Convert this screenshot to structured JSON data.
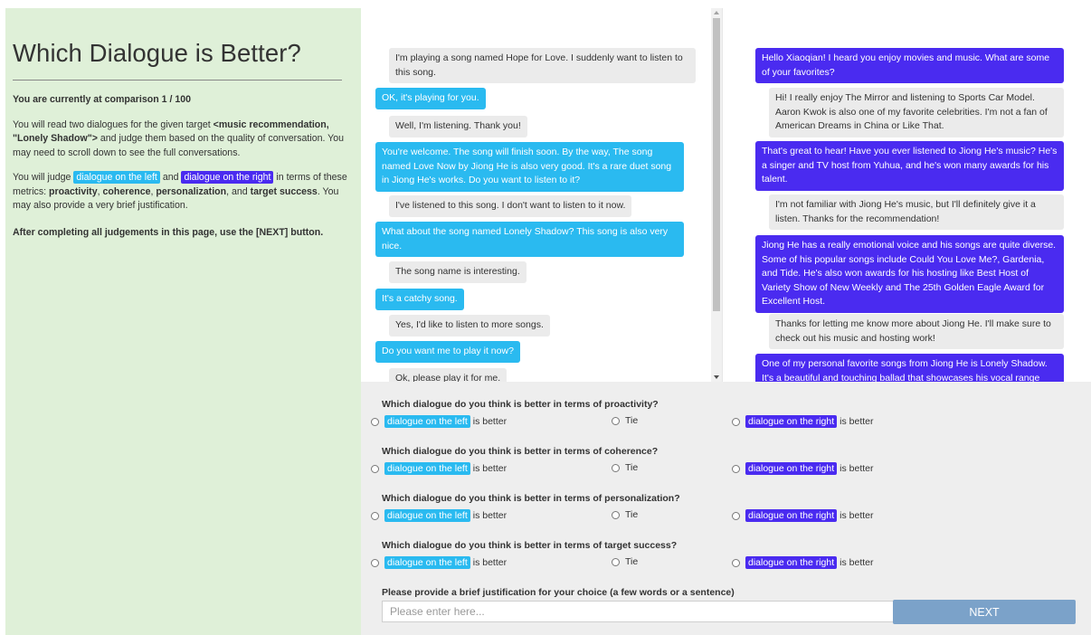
{
  "instructions": {
    "title": "Which Dialogue is Better?",
    "progress": "You are currently at comparison 1 / 100",
    "p1_pre": "You will read two dialogues for the given target ",
    "p1_target": "<music recommendation, \"Lonely Shadow\">",
    "p1_post": " and judge them based on the quality of conversation.   You may need to scroll down to see the full conversations.",
    "p2_pre": "You will judge ",
    "left_tag": "dialogue on the left",
    "and": " and ",
    "right_tag": "dialogue on the right",
    "p2_mid": " in terms of these metrics: ",
    "m1": "proactivity",
    "sep": ", ",
    "m2": "coherence",
    "m3": "personalization",
    "and2": ", and ",
    "m4": "target success",
    "p2_post": ". You may also provide a very brief justification.",
    "p3": "After completing all judgements in this page, use the [NEXT] button."
  },
  "dialogue_left": [
    {
      "role": "user",
      "text": "I'm playing a song named Hope for Love. I suddenly want to listen to this song."
    },
    {
      "role": "system",
      "text": "OK, it's playing for you."
    },
    {
      "role": "user",
      "text": "Well, I'm listening. Thank you!"
    },
    {
      "role": "system",
      "text": "You're welcome. The song will finish soon. By the way, The song named Love Now by Jiong He is also very good. It's a rare duet song in Jiong He's works. Do you want to listen to it?"
    },
    {
      "role": "user",
      "text": "I've listened to this song. I don't want to listen to it now."
    },
    {
      "role": "system",
      "text": "What about the song named Lonely Shadow? This song is also very nice."
    },
    {
      "role": "user",
      "text": "The song name is interesting."
    },
    {
      "role": "system",
      "text": "It's a catchy song."
    },
    {
      "role": "user",
      "text": "Yes, I'd like to listen to more songs."
    },
    {
      "role": "system",
      "text": "Do you want me to play it now?"
    },
    {
      "role": "user",
      "text": "Ok, please play it for me."
    }
  ],
  "dialogue_right": [
    {
      "role": "system",
      "text": "Hello Xiaoqian! I heard you enjoy movies and music. What are some of your favorites?"
    },
    {
      "role": "user",
      "text": "Hi! I really enjoy The Mirror and listening to Sports Car Model. Aaron Kwok is also one of my favorite celebrities. I'm not a fan of American Dreams in China or Like That."
    },
    {
      "role": "system",
      "text": "That's great to hear! Have you ever listened to Jiong He's music? He's a singer and TV host from Yuhua, and he's won many awards for his talent."
    },
    {
      "role": "user",
      "text": "I'm not familiar with Jiong He's music, but I'll definitely give it a listen. Thanks for the recommendation!"
    },
    {
      "role": "system",
      "text": "Jiong He has a really emotional voice and his songs are quite diverse. Some of his popular songs include Could You Love Me?, Gardenia, and Tide. He's also won awards for his hosting like Best Host of Variety Show of New Weekly and The 25th Golden Eagle Award for Excellent Host."
    },
    {
      "role": "user",
      "text": "Thanks for letting me know more about Jiong He. I'll make sure to check out his music and hosting work!"
    },
    {
      "role": "system",
      "text": "One of my personal favorite songs from Jiong He is Lonely Shadow. It's a beautiful and touching ballad that showcases his vocal range and emotion."
    }
  ],
  "judgement": {
    "questions": [
      "Which dialogue do you think is better in terms of proactivity?",
      "Which dialogue do you think is better in terms of coherence?",
      "Which dialogue do you think is better in terms of personalization?",
      "Which dialogue do you think is better in terms of target success?"
    ],
    "left_tag": "dialogue on the left",
    "right_tag": "dialogue on the right",
    "is_better": "is better",
    "tie": "Tie",
    "justification_label": "Please provide a brief justification for your choice (a few words or a sentence)",
    "justification_placeholder": "Please enter here...",
    "next_label": "NEXT"
  },
  "colors": {
    "left_accent": "#2abaf0",
    "right_accent": "#4a2bf0",
    "instruction_bg": "#dff0d8",
    "next_button": "#7ba2c9"
  }
}
